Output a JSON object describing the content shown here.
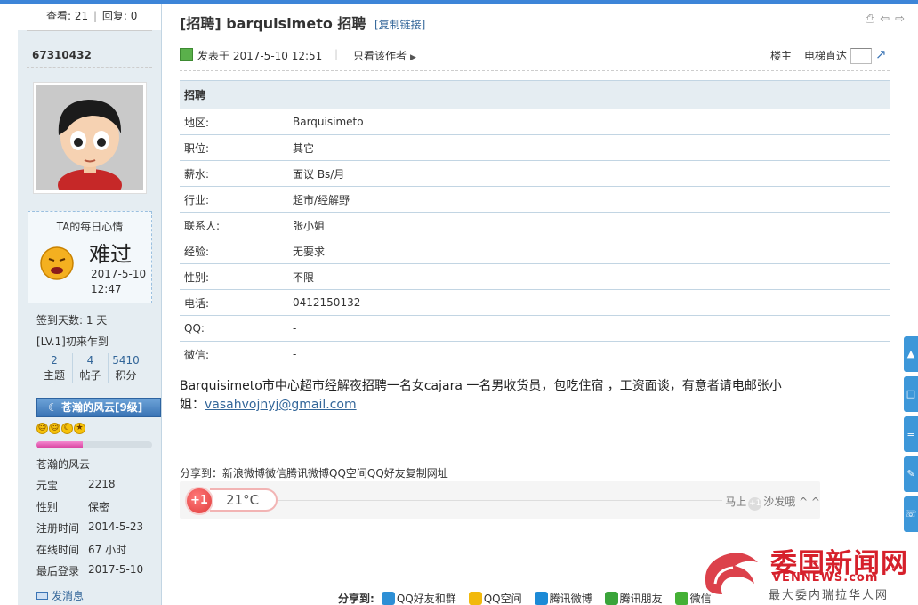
{
  "stats": {
    "views_label": "查看:",
    "views": "21",
    "sep": "|",
    "replies_label": "回复:",
    "replies": "0"
  },
  "author": {
    "name": "67310432",
    "mood_title": "TA的每日心情",
    "mood_word": "难过",
    "mood_date": "2017-5-10",
    "mood_time": "12:47",
    "checkin": "签到天数: 1 天",
    "level": "[LV.1]初来乍到",
    "counts": [
      {
        "n": "2",
        "label": "主题"
      },
      {
        "n": "4",
        "label": "帖子"
      },
      {
        "n": "5410",
        "label": "积分"
      }
    ],
    "group": "苍瀚的风云[9级]",
    "level_progress": 0.4,
    "nickname": "苍瀚的风云",
    "info": [
      {
        "k": "元宝",
        "v": "2218"
      },
      {
        "k": "性别",
        "v": "保密"
      },
      {
        "k": "注册时间",
        "v": "2014-5-23"
      },
      {
        "k": "在线时间",
        "v": "67 小时"
      },
      {
        "k": "最后登录",
        "v": "2017-5-10"
      }
    ],
    "send_msg": "发消息"
  },
  "thread": {
    "title": "[招聘] barquisimeto 招聘",
    "copy_link": "[复制链接]"
  },
  "post": {
    "posted": "发表于 2017-5-10 12:51",
    "sep": "|",
    "only_author": "只看该作者",
    "floor": "楼主",
    "elevator": "电梯直达",
    "table_header": "招聘",
    "rows": [
      {
        "k": "地区:",
        "v": "Barquisimeto"
      },
      {
        "k": "职位:",
        "v": "其它"
      },
      {
        "k": "薪水:",
        "v": "面议 Bs/月"
      },
      {
        "k": "行业:",
        "v": "超市/经解野"
      },
      {
        "k": "联系人:",
        "v": "张小姐"
      },
      {
        "k": "经验:",
        "v": "无要求"
      },
      {
        "k": "性别:",
        "v": "不限"
      },
      {
        "k": "电话:",
        "v": "0412150132"
      },
      {
        "k": "QQ:",
        "v": "-"
      },
      {
        "k": "微信:",
        "v": "-"
      }
    ],
    "body": "Barquisimeto市中心超市经解夜招聘一名女cajara 一名男收货员，包吃住宿 ，工资面谈，有意者请电邮张小姐：",
    "email": "vasahvojnyj@gmail.com",
    "share_top": "分享到：新浪微博微信腾讯微博QQ空间QQ好友复制网址",
    "plus_one": "+1",
    "temperature": "21°C",
    "sofa_a": "马上",
    "sofa_mini": "+1",
    "sofa_b": "沙发哦 ^ ^"
  },
  "share_bottom": {
    "label": "分享到:",
    "items": [
      {
        "label": "QQ好友和群",
        "color": "#2d8fd5"
      },
      {
        "label": "QQ空间",
        "color": "#f2b90c"
      },
      {
        "label": "腾讯微博",
        "color": "#1c8ad6"
      },
      {
        "label": "腾讯朋友",
        "color": "#3aa43a"
      },
      {
        "label": "微信",
        "color": "#44b035"
      }
    ]
  },
  "watermark": {
    "title": "委国新闻网",
    "url": "VENNEWS.com",
    "sub": "最大委内瑞拉华人网"
  },
  "colors": {
    "accent": "#3d85d8",
    "link": "#336699",
    "panel": "#e5edf2",
    "brand_red": "#d6202b"
  }
}
